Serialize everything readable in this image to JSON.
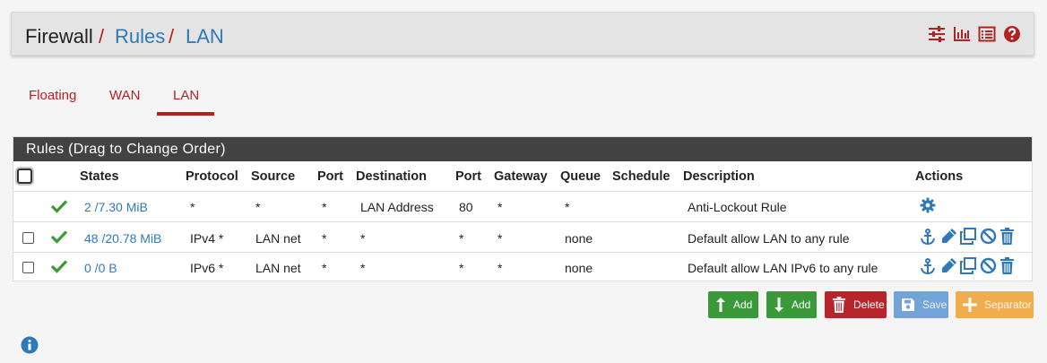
{
  "breadcrumb": {
    "firewall": "Firewall",
    "sep1": "/",
    "rules": "Rules",
    "sep2": "/",
    "lan": "LAN"
  },
  "header_icons": [
    "settings-sliders-icon",
    "bar-chart-icon",
    "list-icon",
    "help-icon"
  ],
  "tabs": [
    {
      "label": "Floating",
      "active": false
    },
    {
      "label": "WAN",
      "active": false
    },
    {
      "label": "LAN",
      "active": true
    }
  ],
  "panel": {
    "title": "Rules (Drag to Change Order)"
  },
  "columns": [
    "States",
    "Protocol",
    "Source",
    "Port",
    "Destination",
    "Port",
    "Gateway",
    "Queue",
    "Schedule",
    "Description",
    "Actions"
  ],
  "rows": [
    {
      "checkbox": false,
      "states": "2 /7.30 MiB",
      "protocol": "*",
      "source": "*",
      "src_port": "*",
      "destination": "LAN Address",
      "dst_port": "80",
      "gateway": "*",
      "queue": "*",
      "schedule": "",
      "description": "Anti-Lockout Rule",
      "actions": [
        "gear-icon"
      ]
    },
    {
      "checkbox": true,
      "states": "48 /20.78 MiB",
      "protocol": "IPv4 *",
      "source": "LAN net",
      "src_port": "*",
      "destination": "*",
      "dst_port": "*",
      "gateway": "*",
      "queue": "none",
      "schedule": "",
      "description": "Default allow LAN to any rule",
      "actions": [
        "anchor-icon",
        "pencil-icon",
        "copy-icon",
        "disable-icon",
        "trash-icon"
      ]
    },
    {
      "checkbox": true,
      "states": "0 /0 B",
      "protocol": "IPv6 *",
      "source": "LAN net",
      "src_port": "*",
      "destination": "*",
      "dst_port": "*",
      "gateway": "*",
      "queue": "none",
      "schedule": "",
      "description": "Default allow LAN IPv6 to any rule",
      "actions": [
        "anchor-icon",
        "pencil-icon",
        "copy-icon",
        "disable-icon",
        "trash-icon"
      ]
    }
  ],
  "buttons": {
    "add_top": "Add",
    "add_bottom": "Add",
    "delete": "Delete",
    "save": "Save",
    "separator": "Separator"
  },
  "colors": {
    "accent_red": "#b22222",
    "link_blue": "#3079b8",
    "check_green": "#3a9a3a",
    "panel_head": "#424242"
  }
}
